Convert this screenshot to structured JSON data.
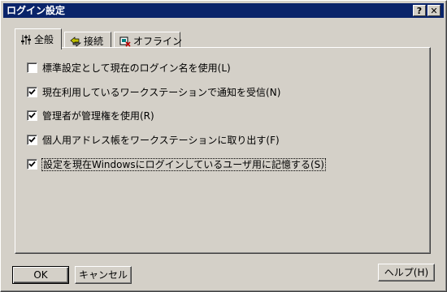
{
  "window": {
    "title": "ログイン設定",
    "help_glyph": "?",
    "close_glyph": "✕"
  },
  "tabs": [
    {
      "label": "全般",
      "icon": "sliders-icon",
      "active": true
    },
    {
      "label": "接続",
      "icon": "connection-icon",
      "active": false
    },
    {
      "label": "オフライン",
      "icon": "offline-icon",
      "active": false
    }
  ],
  "options": [
    {
      "label": "標準設定として現在のログイン名を使用(L)",
      "checked": false
    },
    {
      "label": "現在利用しているワークステーションで通知を受信(N)",
      "checked": true
    },
    {
      "label": "管理者が管理権を使用(R)",
      "checked": true
    },
    {
      "label": "個人用アドレス帳をワークステーションに取り出す(F)",
      "checked": true
    },
    {
      "label": "設定を現在Windowsにログインしているユーザ用に記憶する(S)",
      "checked": true,
      "focused": true
    }
  ],
  "buttons": {
    "ok": "OK",
    "cancel": "キャンセル",
    "help": "ヘルプ(H)"
  }
}
